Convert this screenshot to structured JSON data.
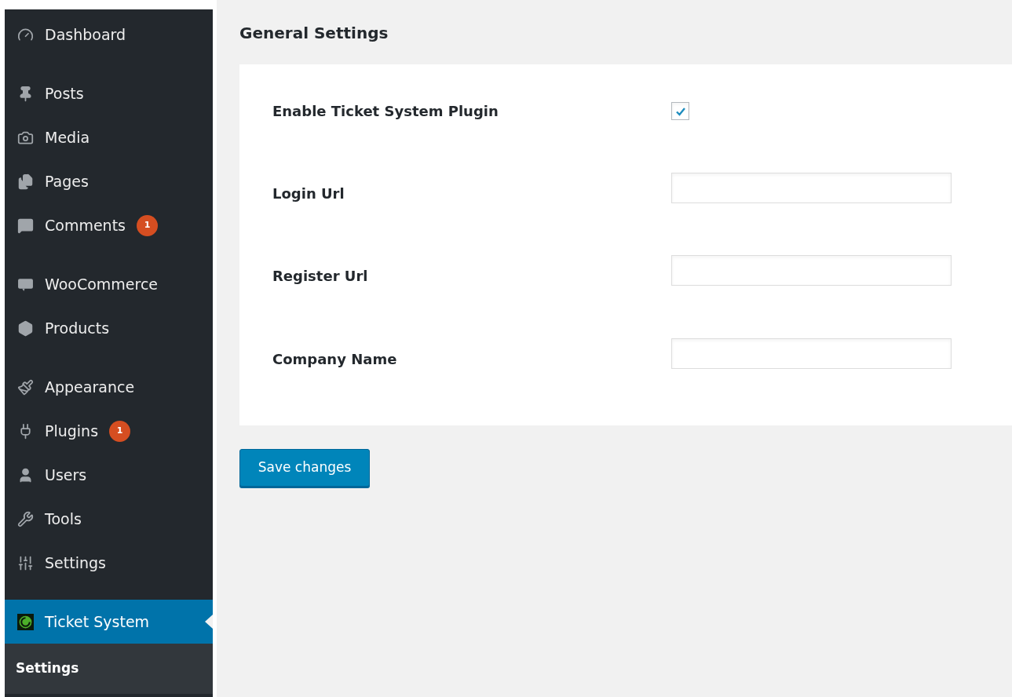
{
  "sidebar": {
    "groups": [
      [
        {
          "label": "Dashboard",
          "selected": false
        }
      ],
      [
        {
          "label": "Posts",
          "selected": false
        },
        {
          "label": "Media",
          "selected": false
        },
        {
          "label": "Pages",
          "selected": false
        },
        {
          "label": "Comments",
          "selected": false,
          "badge": "1"
        }
      ],
      [
        {
          "label": "WooCommerce",
          "selected": false
        },
        {
          "label": "Products",
          "selected": false
        }
      ],
      [
        {
          "label": "Appearance",
          "selected": false
        },
        {
          "label": "Plugins",
          "selected": false,
          "badge": "1"
        },
        {
          "label": "Users",
          "selected": false
        },
        {
          "label": "Tools",
          "selected": false
        },
        {
          "label": "Settings",
          "selected": false
        }
      ],
      [
        {
          "label": "Ticket System",
          "selected": true
        }
      ]
    ],
    "submenu": [
      {
        "label": "Settings",
        "selected": true
      }
    ]
  },
  "page": {
    "title": "General Settings",
    "fields": [
      {
        "kind": "checkbox",
        "label": "Enable Ticket System Plugin",
        "checked": true
      },
      {
        "kind": "text",
        "label": "Login Url"
      },
      {
        "kind": "text",
        "label": "Register Url"
      },
      {
        "kind": "text",
        "label": "Company Name"
      }
    ],
    "save_button": "Save changes"
  }
}
